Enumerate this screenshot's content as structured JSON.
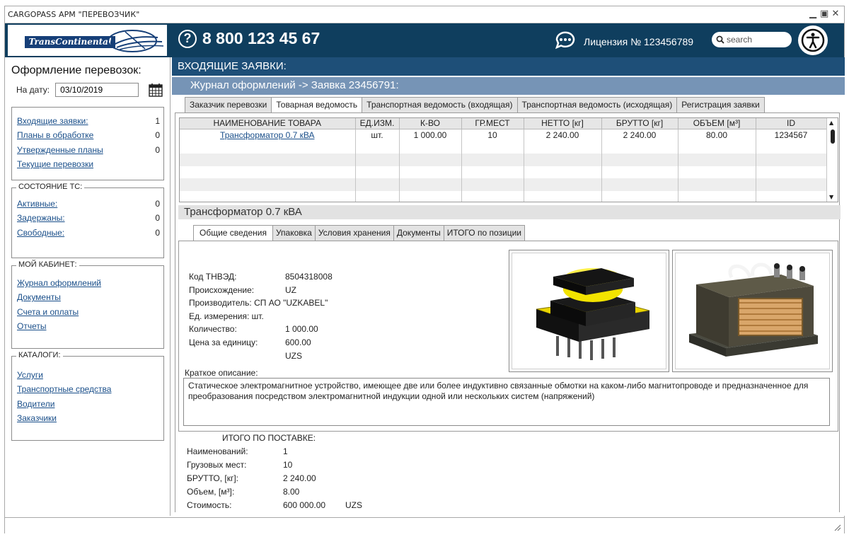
{
  "window": {
    "title": "CARGOPASS АРМ \"ПЕРЕВОЗЧИК\""
  },
  "header": {
    "logo_text": "TransContinental",
    "phone": "8 800 123 45 67",
    "license": "Лицензия № 123456789",
    "search_placeholder": "search"
  },
  "sidebar": {
    "title": "Оформление перевозок:",
    "date_label": "На дату:",
    "date_value": "03/10/2019",
    "requests": [
      {
        "label": "Входящие заявки:",
        "count": "1"
      },
      {
        "label": "Планы в обработке",
        "count": "0"
      },
      {
        "label": "Утвержденные планы",
        "count": "0"
      },
      {
        "label": "Текущие перевозки",
        "count": ""
      }
    ],
    "vehicle_state": {
      "legend": "СОСТОЯНИЕ ТС:",
      "items": [
        {
          "label": "Активные:",
          "count": "0"
        },
        {
          "label": "Задержаны:",
          "count": "0"
        },
        {
          "label": "Свободные:",
          "count": "0"
        }
      ]
    },
    "cabinet": {
      "legend": "МОЙ КАБИНЕТ:",
      "items": [
        "Журнал оформлений",
        "Документы",
        "Счета и оплаты",
        "Отчеты"
      ]
    },
    "catalogs": {
      "legend": "КАТАЛОГИ:",
      "items": [
        "Услуги",
        "Транспортные средства",
        "Водители",
        "Заказчики"
      ]
    }
  },
  "main": {
    "header": "ВХОДЯЩИЕ ЗАЯВКИ:",
    "breadcrumb": "Журнал оформлений -> Заявка 23456791:",
    "tabs": [
      "Заказчик перевозки",
      "Товарная ведомость",
      "Транспортная ведомость (входящая)",
      "Транспортная ведомость (исходящая)",
      "Регистрация заявки"
    ],
    "active_tab": "Товарная ведомость",
    "table": {
      "columns": [
        "НАИМЕНОВАНИЕ ТОВАРА",
        "ЕД.ИЗМ.",
        "К-ВО",
        "ГР.МЕСТ",
        "НЕТТО [кг]",
        "БРУТТО [кг]",
        "ОБЪЕМ [м³]",
        "ID"
      ],
      "rows": [
        [
          "Трансформатор 0.7 кВА",
          "шт.",
          "1 000.00",
          "10",
          "2 240.00",
          "2 240.00",
          "80.00",
          "1234567"
        ]
      ]
    },
    "item_title": "Трансформатор 0.7 кВА",
    "subtabs": [
      "Общие сведения",
      "Упаковка",
      "Условия хранения",
      "Документы",
      "ИТОГО по позиции"
    ],
    "active_subtab": "Общие сведения",
    "details": [
      {
        "label": "Код ТНВЭД:",
        "value": "8504318008"
      },
      {
        "label": "Происхождение:",
        "value": "UZ"
      },
      {
        "label": "Производитель: СП АО \"UZKABEL\"",
        "value": ""
      },
      {
        "label": "Ед. измерения:  шт.",
        "value": ""
      },
      {
        "label": "Количество:",
        "value": "1 000.00"
      },
      {
        "label": "Цена за единицу:",
        "value": "600.00"
      },
      {
        "label": "",
        "value": "UZS"
      }
    ],
    "short_desc_label": "Краткое описание:",
    "short_desc": "Статическое электромагнитное устройство, имеющее две или более индуктивно связанные обмотки на каком-либо магнитопроводе и предназначенное для преобразования посредством электромагнитной индукции одной или нескольких систем (напряжений)",
    "totals": {
      "title": "ИТОГО ПО ПОСТАВКЕ:",
      "rows": [
        {
          "label": "Наименований:",
          "value": "1",
          "unit": ""
        },
        {
          "label": "Грузовых мест:",
          "value": "10",
          "unit": ""
        },
        {
          "label": "БРУТТО, [кг]:",
          "value": "2 240.00",
          "unit": ""
        },
        {
          "label": "Объем, [м³]:",
          "value": "8.00",
          "unit": ""
        },
        {
          "label": "Стоимость:",
          "value": "600 000.00",
          "unit": "UZS"
        }
      ]
    }
  },
  "colors": {
    "header_bg": "#0f3e5e",
    "main_header_bg": "#1e4f78",
    "breadcrumb_bg": "#7694b6",
    "link": "#1a4f8a"
  }
}
